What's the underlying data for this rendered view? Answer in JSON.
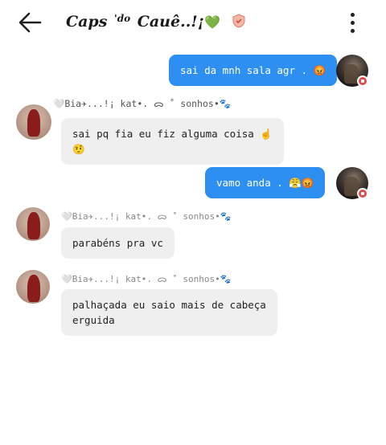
{
  "header": {
    "title_main": "Caps",
    "title_sup": "'do",
    "title_name": "Cauê..!¡",
    "title_emoji": "💚",
    "back_icon": "back-arrow-icon",
    "menu_icon": "more-vertical-icon"
  },
  "sender_name": "🤍Bia✈...!¡ kat•. ᯅ ˚ sonhos•🐾",
  "messages": [
    {
      "text": "sai da mnh sala agr . 😡",
      "direction": "out"
    },
    {
      "text": "sai pq fia eu fiz alguma coisa ☝️",
      "text2": "🤨",
      "direction": "in"
    },
    {
      "text": "vamo anda . 😤😡",
      "direction": "out"
    },
    {
      "text": "parabéns pra vc",
      "direction": "in"
    },
    {
      "text": "palhaçada eu saio mais de cabeça",
      "text2": "erguida",
      "direction": "in"
    }
  ],
  "colors": {
    "outgoing": "#2d8ff2",
    "incoming": "#efefef",
    "badge": "#e44b4b"
  }
}
